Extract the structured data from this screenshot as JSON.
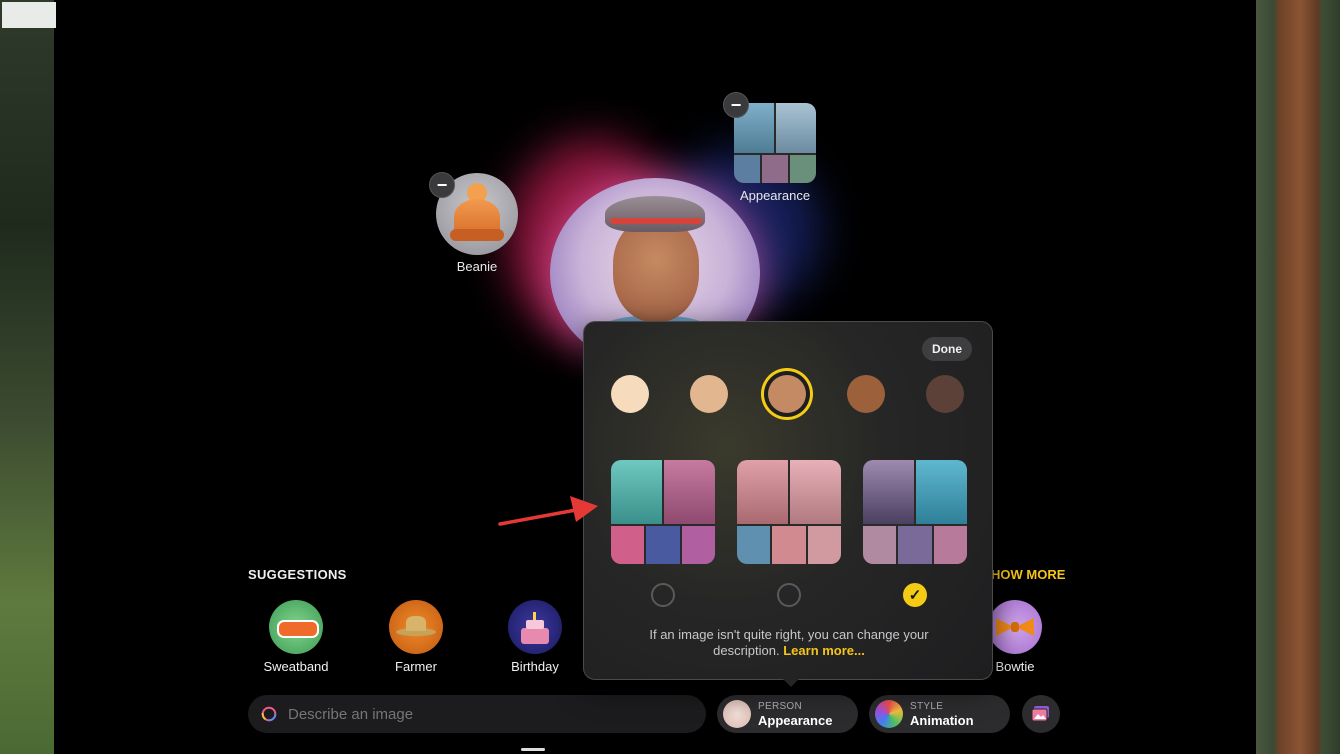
{
  "floating_items": {
    "beanie": {
      "label": "Beanie"
    },
    "appearance": {
      "label": "Appearance"
    }
  },
  "popover": {
    "done_label": "Done",
    "skin_tones": [
      "#f6dcbc",
      "#e2b68e",
      "#c38a64",
      "#9c613b",
      "#5b4137"
    ],
    "selected_skin_tone_index": 2,
    "selected_appearance_index": 2,
    "message": "If an image isn't quite right, you can change your description.",
    "link": "Learn more..."
  },
  "suggestions": {
    "title": "SUGGESTIONS",
    "show_more": "HOW MORE",
    "items": [
      {
        "label": "Sweatband",
        "icon": "sweatband-icon"
      },
      {
        "label": "Farmer",
        "icon": "straw-hat-icon"
      },
      {
        "label": "Birthday",
        "icon": "birthday-cake-icon"
      },
      {
        "label": "Bowtie",
        "icon": "bowtie-icon"
      }
    ]
  },
  "prompt": {
    "placeholder": "Describe an image"
  },
  "person_pill": {
    "small": "PERSON",
    "big": "Appearance"
  },
  "style_pill": {
    "small": "STYLE",
    "big": "Animation"
  },
  "colors": {
    "accent": "#f4cc14",
    "annotation_arrow": "#e53935"
  }
}
